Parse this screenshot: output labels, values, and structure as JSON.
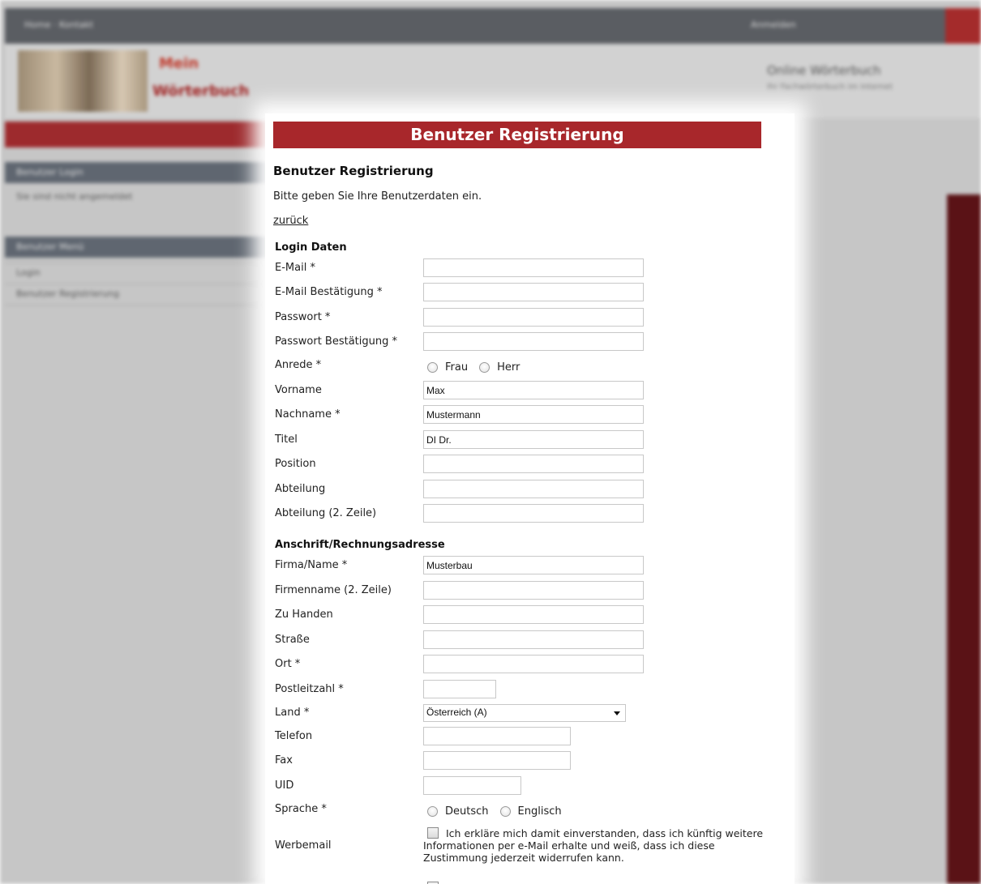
{
  "background": {
    "top_links": "Home · Kontakt",
    "top_right": "Anmelden",
    "logo_line1": "Mein",
    "logo_line2": "Wörterbuch",
    "header_right": "Online Wörterbuch",
    "header_right_sub": "Ihr Fachwörterbuch im Internet",
    "box1_title": "Benutzer Login",
    "box1_text": "Sie sind nicht angemeldet",
    "box2_title": "Benutzer Menü",
    "box2_items": [
      "Login",
      "Benutzer Registrierung"
    ]
  },
  "modal": {
    "title": "Benutzer Registrierung",
    "heading": "Benutzer Registrierung",
    "intro": "Bitte geben Sie Ihre Benutzerdaten ein.",
    "back_link": "zurück",
    "section_login": "Login Daten",
    "section_address": "Anschrift/Rechnungsadresse",
    "fields": {
      "email": {
        "label": "E-Mail *",
        "value": ""
      },
      "email_confirm": {
        "label": "E-Mail Bestätigung *",
        "value": ""
      },
      "password": {
        "label": "Passwort *",
        "value": ""
      },
      "password_confirm": {
        "label": "Passwort Bestätigung *",
        "value": ""
      },
      "salutation": {
        "label": "Anrede *",
        "options": [
          "Frau",
          "Herr"
        ]
      },
      "firstname": {
        "label": "Vorname",
        "value": "Max"
      },
      "lastname": {
        "label": "Nachname *",
        "value": "Mustermann"
      },
      "title": {
        "label": "Titel",
        "value": "DI Dr."
      },
      "position": {
        "label": "Position",
        "value": ""
      },
      "department": {
        "label": "Abteilung",
        "value": ""
      },
      "department2": {
        "label": "Abteilung (2. Zeile)",
        "value": ""
      },
      "company": {
        "label": "Firma/Name *",
        "value": "Musterbau"
      },
      "company2": {
        "label": "Firmenname (2. Zeile)",
        "value": ""
      },
      "attention": {
        "label": "Zu Handen",
        "value": ""
      },
      "street": {
        "label": "Straße",
        "value": ""
      },
      "city": {
        "label": "Ort *",
        "value": ""
      },
      "zip": {
        "label": "Postleitzahl *",
        "value": ""
      },
      "country": {
        "label": "Land *",
        "value": "Österreich (A)"
      },
      "phone": {
        "label": "Telefon",
        "value": ""
      },
      "fax": {
        "label": "Fax",
        "value": ""
      },
      "uid": {
        "label": "UID",
        "value": ""
      },
      "language": {
        "label": "Sprache *",
        "options": [
          "Deutsch",
          "Englisch"
        ]
      },
      "newsletter": {
        "label": "Werbemail",
        "text": "Ich erkläre mich damit einverstanden, dass ich künftig weitere Informationen per e-Mail erhalte und weiß, dass ich diese Zustimmung jederzeit widerrufen kann."
      }
    }
  },
  "colors": {
    "accent": "#a8272b",
    "background": "#c6c6c6",
    "topbar": "#5a5d62"
  }
}
